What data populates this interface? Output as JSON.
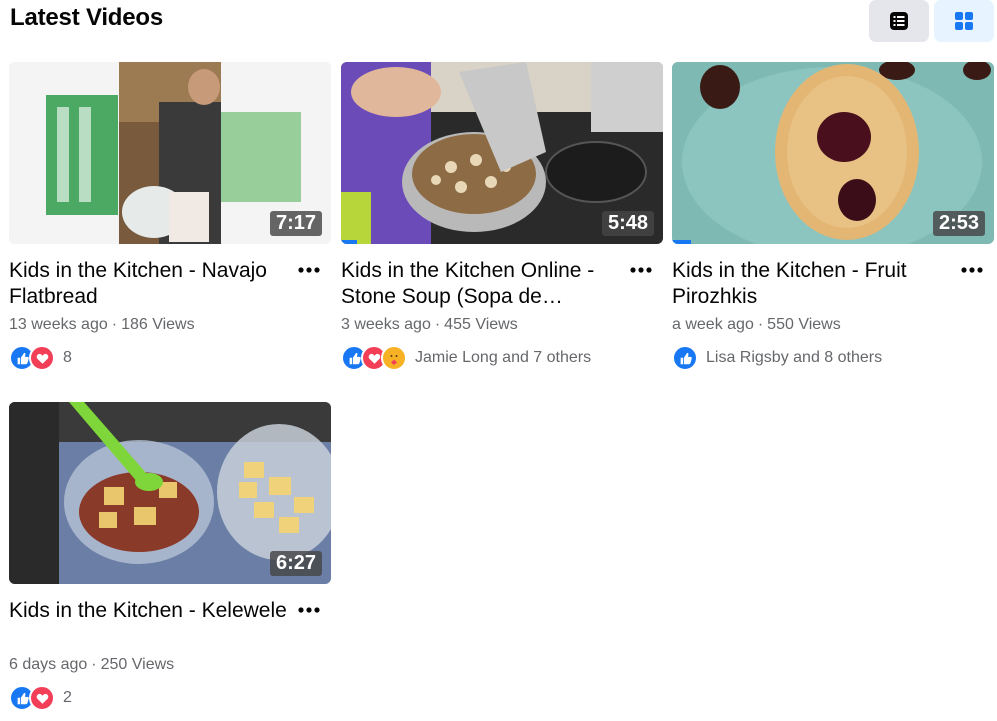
{
  "header": {
    "title": "Latest Videos",
    "list_view_icon": "list-view-icon",
    "grid_view_icon": "grid-view-icon"
  },
  "colors": {
    "accent": "#1877f2",
    "like": "#1877f2",
    "love": "#f33e58",
    "care": "#f7b125",
    "muted_text": "#65676b",
    "view_toggle_bg": "#e4e6eb",
    "view_toggle_active_bg": "#e7f3ff"
  },
  "videos": [
    {
      "title": "Kids in the Kitchen - Navajo Flatbread",
      "duration": "7:17",
      "age": "13 weeks ago",
      "views": "186 Views",
      "reactions": [
        "like",
        "love"
      ],
      "reaction_text": "8"
    },
    {
      "title": "Kids in the Kitchen Online - Stone Soup (Sopa de…",
      "duration": "5:48",
      "progress": 0.05,
      "age": "3 weeks ago",
      "views": "455 Views",
      "reactions": [
        "like",
        "love",
        "care"
      ],
      "reaction_text": "Jamie Long and 7 others"
    },
    {
      "title": "Kids in the Kitchen - Fruit Pirozhkis",
      "duration": "2:53",
      "progress": 0.06,
      "age": "a week ago",
      "views": "550 Views",
      "reactions": [
        "like"
      ],
      "reaction_text": "Lisa Rigsby and 8 others"
    },
    {
      "title": "Kids in the Kitchen - Kelewele",
      "duration": "6:27",
      "age": "6 days ago",
      "views": "250 Views",
      "reactions": [
        "like",
        "love"
      ],
      "reaction_text": "2"
    }
  ]
}
